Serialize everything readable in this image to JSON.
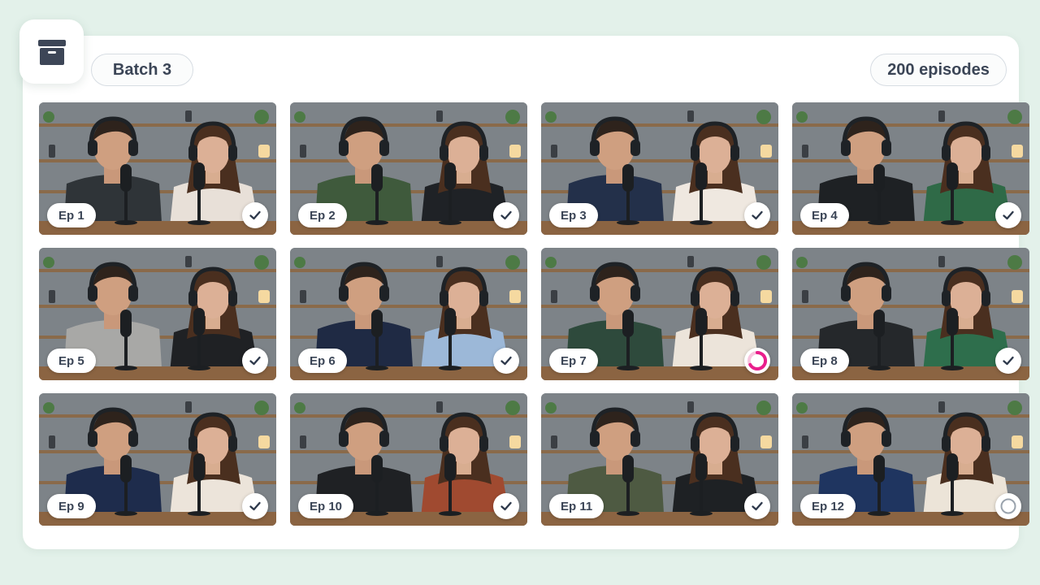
{
  "header": {
    "app_icon": "archive-box-icon",
    "batch_label": "Batch 3",
    "episode_count": "200 episodes"
  },
  "colors": {
    "accent": "#e91e8c",
    "icon_dark": "#3d4657",
    "background": "#e3f1ea"
  },
  "episodes": [
    {
      "label": "Ep 1",
      "status": "done",
      "shirt_left": "#2f3438",
      "shirt_right": "#e8e0d8"
    },
    {
      "label": "Ep 2",
      "status": "done",
      "shirt_left": "#3f5a3c",
      "shirt_right": "#1f2226"
    },
    {
      "label": "Ep 3",
      "status": "done",
      "shirt_left": "#23304a",
      "shirt_right": "#efe8e0"
    },
    {
      "label": "Ep 4",
      "status": "done",
      "shirt_left": "#1e2124",
      "shirt_right": "#2f6a47"
    },
    {
      "label": "Ep 5",
      "status": "done",
      "shirt_left": "#a8a8a6",
      "shirt_right": "#1f2124"
    },
    {
      "label": "Ep 6",
      "status": "done",
      "shirt_left": "#1f2a44",
      "shirt_right": "#9cb8d8"
    },
    {
      "label": "Ep 7",
      "status": "in-progress",
      "shirt_left": "#2e4a3c",
      "shirt_right": "#ece4da"
    },
    {
      "label": "Ep 8",
      "status": "done",
      "shirt_left": "#25282b",
      "shirt_right": "#2e6e4c"
    },
    {
      "label": "Ep 9",
      "status": "done",
      "shirt_left": "#1e2c4c",
      "shirt_right": "#ece4da"
    },
    {
      "label": "Ep 10",
      "status": "done",
      "shirt_left": "#1f2124",
      "shirt_right": "#a04a30"
    },
    {
      "label": "Ep 11",
      "status": "done",
      "shirt_left": "#4e5a42",
      "shirt_right": "#1e2124"
    },
    {
      "label": "Ep 12",
      "status": "pending",
      "shirt_left": "#1f3560",
      "shirt_right": "#ece4d8"
    }
  ]
}
